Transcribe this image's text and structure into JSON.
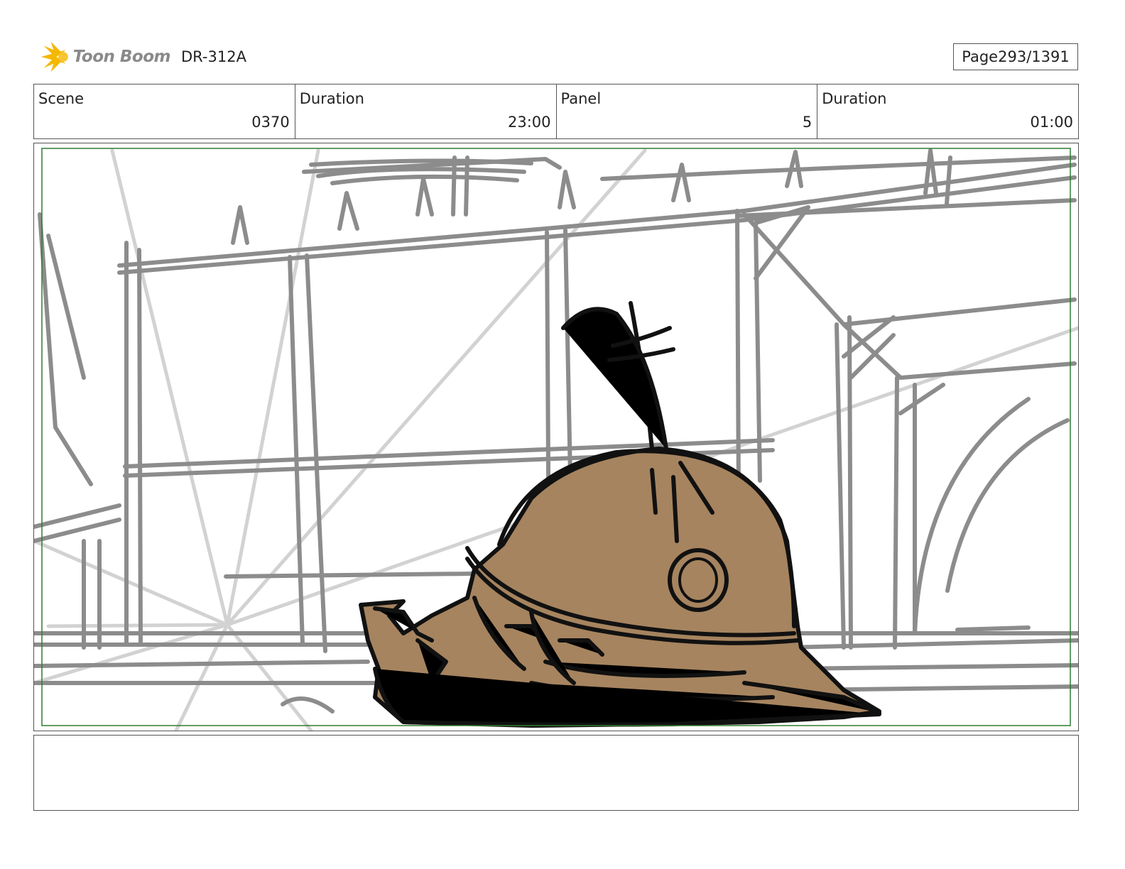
{
  "header": {
    "logo_text": "Toon Boom",
    "document_id": "DR-312A",
    "page_label": "Page",
    "page_number": "293/1391"
  },
  "info_table": [
    {
      "label": "Scene",
      "value": "0370"
    },
    {
      "label": "Duration",
      "value": "23:00"
    },
    {
      "label": "Panel",
      "value": "5"
    },
    {
      "label": "Duration",
      "value": "01:00"
    }
  ],
  "panel": {
    "safe_area_color": "#2e7d32",
    "sketch_color": "#8c8c8c",
    "light_sketch_color": "#d0d0d0",
    "character_fill": "#a6845f",
    "ink_color": "#111111"
  },
  "notes": {
    "text": ""
  },
  "brand": {
    "logo_burst_color": "#f5b800"
  }
}
